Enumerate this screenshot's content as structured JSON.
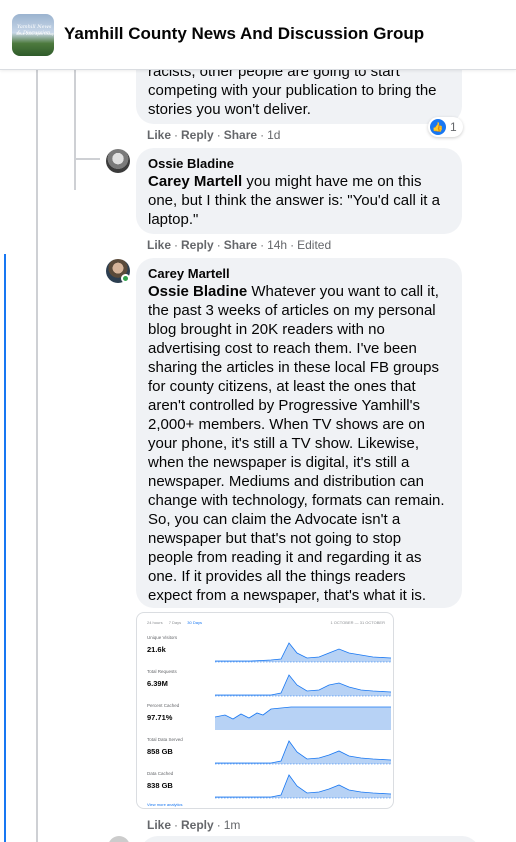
{
  "header": {
    "group_name": "Yamhill County News And Discussion Group",
    "avatar_line1": "Yamhill News & Discussion",
    "avatar_line2": "Since 2009 Open Group"
  },
  "comments": [
    {
      "body": "racists, other people are going to start\ncompeting with your publication to bring the\nstories you won't deliver.",
      "actions": {
        "like": "Like",
        "reply": "Reply",
        "share": "Share",
        "time": "1d"
      },
      "reaction_count": "1"
    },
    {
      "author": "Ossie Bladine",
      "mention": "Carey Martell",
      "body": " you might have me on this\none, but I think the answer is: \"You'd call it a\nlaptop.\"",
      "actions": {
        "like": "Like",
        "reply": "Reply",
        "share": "Share",
        "time": "14h",
        "edited": "Edited"
      }
    },
    {
      "author": "Carey Martell",
      "mention": "Ossie Bladine",
      "body": " Whatever you want to call it,\nthe past 3 weeks of articles on my personal\nblog brought in 20K readers with no\nadvertising cost to reach them. I've been\nsharing the articles in these local FB groups\nfor county citizens, at least the ones that\naren't controlled by Progressive Yamhill's\n2,000+ members. When TV shows are on\nyour phone, it's still a TV show. Likewise,\nwhen the newspaper is digital, it's still a\nnewspaper. Mediums and distribution can\nchange with technology, formats can remain.\nSo, you can claim the Advocate isn't a\nnewspaper but that's not going to stop\npeople from reading it and regarding it as\none. If it provides all the things readers\nexpect from a newspaper, that's what it is.",
      "actions": {
        "like": "Like",
        "reply": "Reply",
        "time": "1m"
      }
    }
  ],
  "analytics": {
    "tabs": [
      "24 hours",
      "7 Days",
      "30 Days"
    ],
    "range": "1 OCTOBER — 31 OCTOBER",
    "footer": "View more analytics",
    "metrics": [
      {
        "label": "Unique Visitors",
        "value": "21.6k"
      },
      {
        "label": "Total Requests",
        "value": "6.39M"
      },
      {
        "label": "Percent Cached",
        "value": "97.71%"
      },
      {
        "label": "Total Data Served",
        "value": "858 GB"
      },
      {
        "label": "Data Cached",
        "value": "838 GB"
      }
    ],
    "accent": "#1877f2"
  }
}
